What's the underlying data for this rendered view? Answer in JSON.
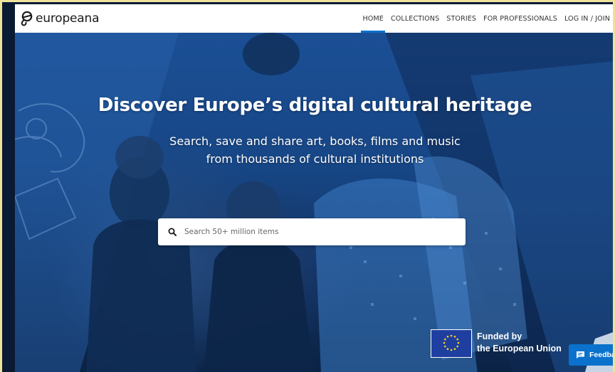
{
  "header": {
    "logo_text": "europeana",
    "nav": [
      {
        "label": "HOME",
        "active": true
      },
      {
        "label": "COLLECTIONS",
        "active": false
      },
      {
        "label": "STORIES",
        "active": false
      },
      {
        "label": "FOR PROFESSIONALS",
        "active": false
      },
      {
        "label": "LOG IN / JOIN",
        "active": false
      }
    ]
  },
  "hero": {
    "headline": "Discover Europe’s digital cultural heritage",
    "subtitle_line1": "Search, save and share art, books, films and music",
    "subtitle_line2": "from thousands of cultural institutions"
  },
  "search": {
    "placeholder": "Search 50+ million items",
    "value": ""
  },
  "funding": {
    "line1": "Funded by",
    "line2": "the European Union"
  },
  "feedback": {
    "label": "Feedback"
  },
  "colors": {
    "accent": "#0a72cc",
    "hero_blue": "#1b4f95",
    "eu_flag_blue": "#1f3fa0",
    "eu_stars": "#ffd617"
  },
  "icons": [
    "europeana-logo-icon",
    "search-icon",
    "eu-flag-icon",
    "feedback-chat-icon"
  ]
}
